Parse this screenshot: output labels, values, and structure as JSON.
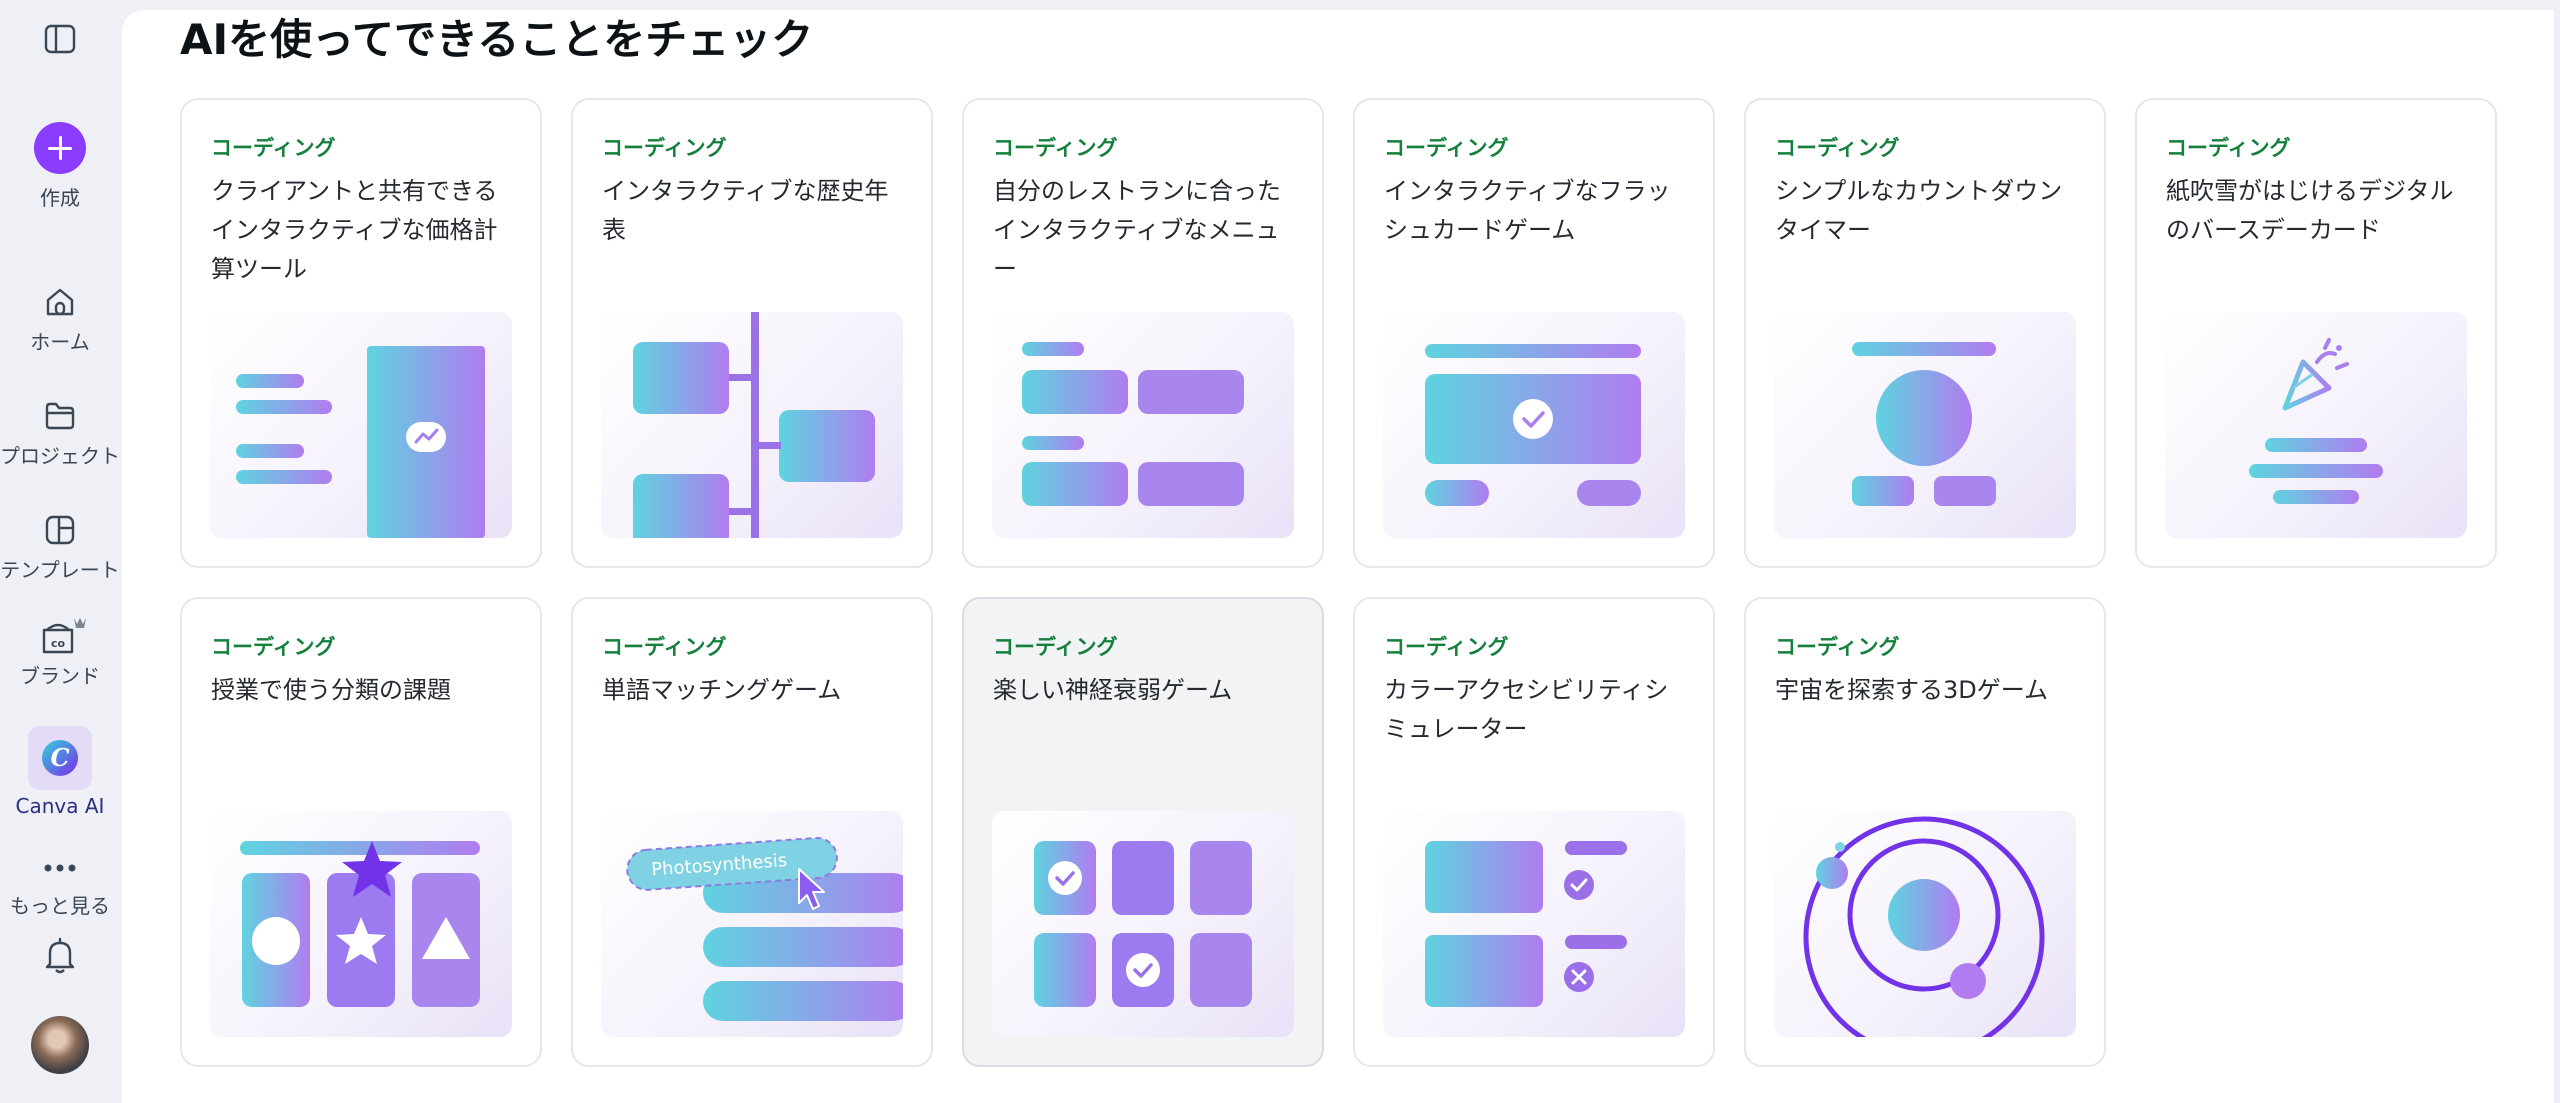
{
  "sidebar": {
    "create_label": "作成",
    "items": [
      {
        "label": "ホーム",
        "icon": "home-icon"
      },
      {
        "label": "プロジェクト",
        "icon": "folder-icon"
      },
      {
        "label": "テンプレート",
        "icon": "template-icon"
      },
      {
        "label": "ブランド",
        "icon": "brand-icon"
      },
      {
        "label": "Canva AI",
        "icon": "canva-ai-icon"
      },
      {
        "label": "もっと見る",
        "icon": "more-icon"
      }
    ],
    "ai_badge_letter": "C",
    "notification_icon": "bell-icon",
    "collapse_icon": "sidebar-toggle-icon"
  },
  "main": {
    "title": "AIを使ってできることをチェック",
    "cards": [
      {
        "tag": "コーディング",
        "title": "クライアントと共有できるインタラクティブな価格計算ツール"
      },
      {
        "tag": "コーディング",
        "title": "インタラクティブな歴史年表"
      },
      {
        "tag": "コーディング",
        "title": "自分のレストランに合ったインタラクティブなメニュー"
      },
      {
        "tag": "コーディング",
        "title": "インタラクティブなフラッシュカードゲーム"
      },
      {
        "tag": "コーディング",
        "title": "シンプルなカウントダウンタイマー"
      },
      {
        "tag": "コーディング",
        "title": "紙吹雪がはじけるデジタルのバースデーカード"
      },
      {
        "tag": "コーディング",
        "title": "授業で使う分類の課題"
      },
      {
        "tag": "コーディング",
        "title": "単語マッチングゲーム",
        "illustration_text": "Photosynthesis"
      },
      {
        "tag": "コーディング",
        "title": "楽しい神経衰弱ゲーム"
      },
      {
        "tag": "コーディング",
        "title": "カラーアクセシビリティシミュレーター"
      },
      {
        "tag": "コーディング",
        "title": "宇宙を探索する3Dゲーム"
      }
    ]
  },
  "colors": {
    "accent": "#8b3dff",
    "tag_green": "#15803d",
    "grad_start": "#5fd3e0",
    "grad_end": "#b07cf0"
  }
}
